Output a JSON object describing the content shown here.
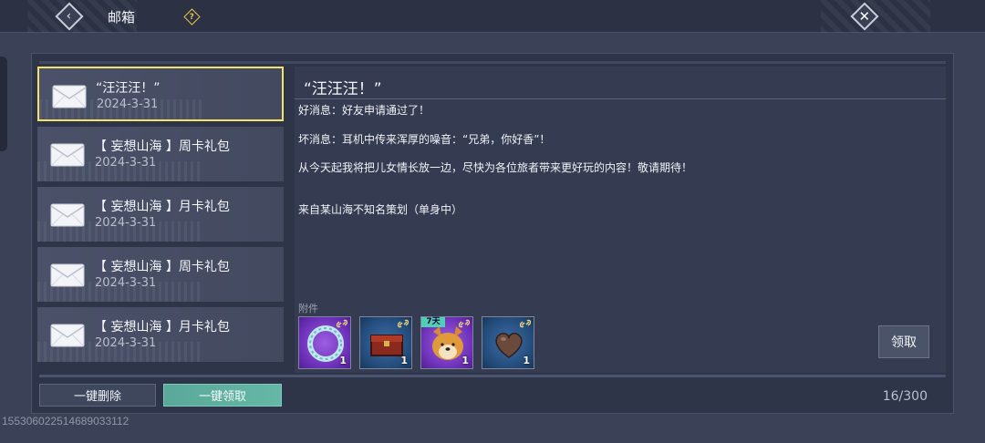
{
  "header": {
    "title": "邮箱",
    "back_icon": "back-arrow-icon",
    "help_icon": "question-icon",
    "close_icon": "close-x-icon"
  },
  "mail_list": [
    {
      "subject": "“汪汪汪！”",
      "date": "2024-3-31",
      "selected": true
    },
    {
      "subject": "【 妄想山海 】周卡礼包",
      "date": "2024-3-31",
      "selected": false
    },
    {
      "subject": "【 妄想山海 】月卡礼包",
      "date": "2024-3-31",
      "selected": false
    },
    {
      "subject": "【 妄想山海 】周卡礼包",
      "date": "2024-3-31",
      "selected": false
    },
    {
      "subject": "【 妄想山海 】月卡礼包",
      "date": "2024-3-31",
      "selected": false
    }
  ],
  "detail": {
    "title": "“汪汪汪！”",
    "lines": [
      "好消息：好友申请通过了！",
      "坏消息：耳机中传来浑厚的噪音：“兄弟，你好香”！",
      "从今天起我将把儿女情长放一边，尽快为各位旅者带来更好玩的内容！敬请期待！",
      "来自某山海不知名策划（单身中）"
    ],
    "attachments_label": "附件",
    "attachments": [
      {
        "icon": "jade-ring-icon",
        "count": "1",
        "tag": ""
      },
      {
        "icon": "treasure-chest-icon",
        "count": "1",
        "tag": ""
      },
      {
        "icon": "shiba-dog-icon",
        "count": "1",
        "tag": "7天"
      },
      {
        "icon": "heart-stone-icon",
        "count": "1",
        "tag": ""
      }
    ],
    "claim_label": "领取"
  },
  "footer": {
    "delete_all_label": "一键删除",
    "claim_all_label": "一键领取",
    "mail_count": "16/300"
  },
  "user_id": "1553060225146890331​12",
  "colors": {
    "selected_border": "#f3e16a",
    "claim_all_bg": "#5aa89a",
    "help_accent": "#e6c34a"
  }
}
